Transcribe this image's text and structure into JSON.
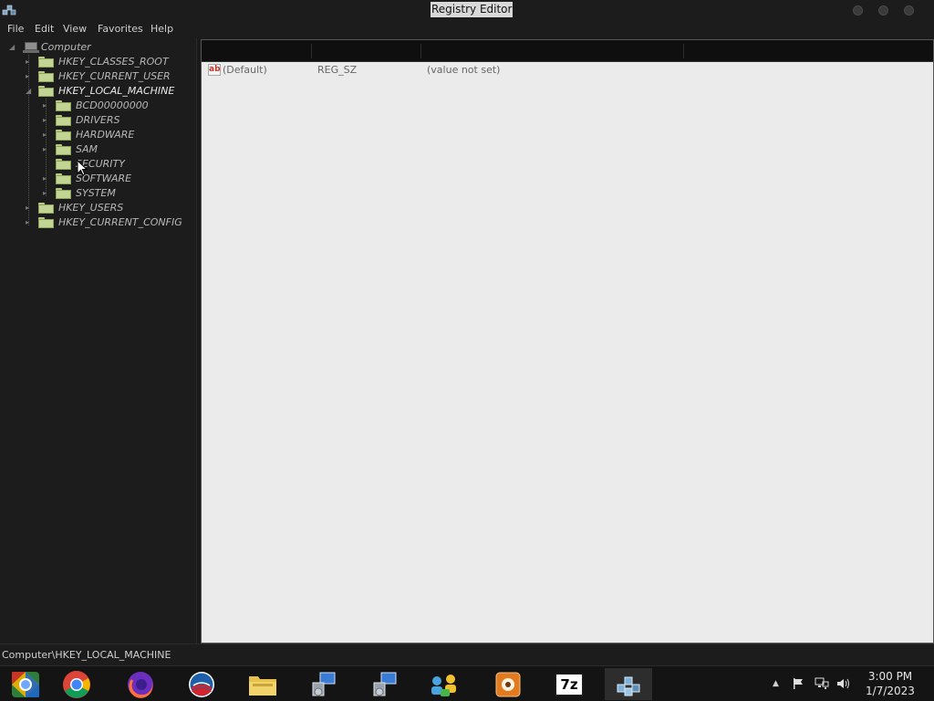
{
  "window": {
    "title": "Registry Editor"
  },
  "menu": [
    "File",
    "Edit",
    "View",
    "Favorites",
    "Help"
  ],
  "tree": {
    "root": "Computer",
    "hives": [
      "HKEY_CLASSES_ROOT",
      "HKEY_CURRENT_USER",
      "HKEY_LOCAL_MACHINE",
      "HKEY_USERS",
      "HKEY_CURRENT_CONFIG"
    ],
    "hklm_children": [
      "BCD00000000",
      "DRIVERS",
      "HARDWARE",
      "SAM",
      "SECURITY",
      "SOFTWARE",
      "SYSTEM"
    ],
    "selected": "HKEY_LOCAL_MACHINE"
  },
  "values": {
    "rows": [
      {
        "icon": "string-value-icon",
        "icon_text": "ab",
        "name": "(Default)",
        "type": "REG_SZ",
        "data": "(value not set)"
      }
    ]
  },
  "status": {
    "path": "Computer\\HKEY_LOCAL_MACHINE"
  },
  "taskbar": {
    "apps": [
      "start-orb",
      "chrome",
      "firefox",
      "obama-logo-app",
      "file-explorer",
      "setup-installer",
      "setup-installer-2",
      "network-app",
      "paint-app",
      "7zip",
      "registry-editor"
    ],
    "sevenzip_label": "7z"
  },
  "tray": {
    "time": "3:00 PM",
    "date": "1/7/2023",
    "icons": [
      "show-hidden-arrow-icon",
      "action-center-flag-icon",
      "network-icon",
      "volume-icon"
    ]
  },
  "colors": {
    "folder": "#c3d594",
    "value_pane": "#ebebeb",
    "panel": "#1c1c1c"
  }
}
